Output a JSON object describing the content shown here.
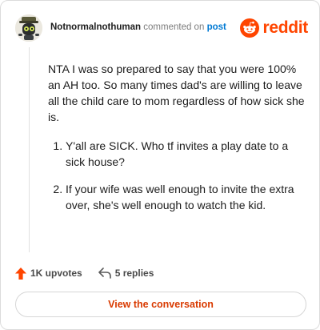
{
  "header": {
    "username": "Notnormalnothuman",
    "commented_text": "commented on",
    "post_link": "post",
    "brand": "reddit",
    "brand_color": "#ff4500",
    "avatar_icon": "robot-avatar-icon"
  },
  "comment": {
    "intro": "NTA I was so prepared to say that you were 100% an AH too. So many times dad's are willing to leave all the child care to mom regardless of how sick she is.",
    "points": [
      "Y'all are SICK. Who tf invites a play date to a sick house?",
      "If your wife was well enough to invite the extra over, she's well enough to watch the kid."
    ]
  },
  "actions": {
    "upvotes": "1K upvotes",
    "replies": "5 replies",
    "upvote_icon": "upvote-arrow-icon",
    "reply_icon": "reply-arrow-icon",
    "upvote_color": "#ff4500"
  },
  "cta": {
    "label": "View the conversation",
    "color": "#d93a00"
  }
}
